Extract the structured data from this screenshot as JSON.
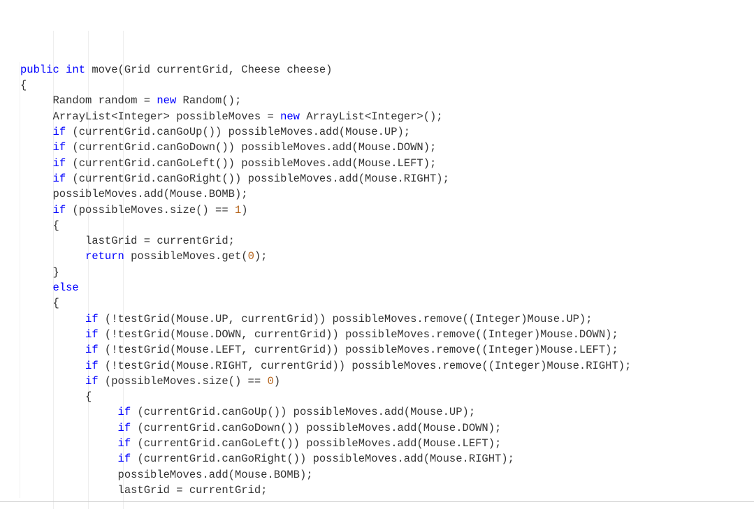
{
  "lines": [
    {
      "indent": 0,
      "tokens": [
        {
          "t": "public",
          "c": "keyword"
        },
        {
          "t": " "
        },
        {
          "t": "int",
          "c": "keyword"
        },
        {
          "t": " move(Grid currentGrid, Cheese cheese)"
        }
      ]
    },
    {
      "indent": 0,
      "tokens": [
        {
          "t": "{"
        }
      ]
    },
    {
      "indent": 5,
      "tokens": [
        {
          "t": "Random random = "
        },
        {
          "t": "new",
          "c": "keyword"
        },
        {
          "t": " Random();"
        }
      ]
    },
    {
      "indent": 5,
      "tokens": [
        {
          "t": "ArrayList<Integer> possibleMoves = "
        },
        {
          "t": "new",
          "c": "keyword"
        },
        {
          "t": " ArrayList<Integer>();"
        }
      ]
    },
    {
      "indent": 5,
      "tokens": [
        {
          "t": "if",
          "c": "keyword"
        },
        {
          "t": " (currentGrid.canGoUp()) possibleMoves.add(Mouse.UP);"
        }
      ]
    },
    {
      "indent": 5,
      "tokens": [
        {
          "t": "if",
          "c": "keyword"
        },
        {
          "t": " (currentGrid.canGoDown()) possibleMoves.add(Mouse.DOWN);"
        }
      ]
    },
    {
      "indent": 5,
      "tokens": [
        {
          "t": "if",
          "c": "keyword"
        },
        {
          "t": " (currentGrid.canGoLeft()) possibleMoves.add(Mouse.LEFT);"
        }
      ]
    },
    {
      "indent": 5,
      "tokens": [
        {
          "t": "if",
          "c": "keyword"
        },
        {
          "t": " (currentGrid.canGoRight()) possibleMoves.add(Mouse.RIGHT);"
        }
      ]
    },
    {
      "indent": 5,
      "tokens": [
        {
          "t": "possibleMoves.add(Mouse.BOMB);"
        }
      ]
    },
    {
      "indent": 0,
      "tokens": [
        {
          "t": ""
        }
      ]
    },
    {
      "indent": 5,
      "tokens": [
        {
          "t": "if",
          "c": "keyword"
        },
        {
          "t": " (possibleMoves.size() == "
        },
        {
          "t": "1",
          "c": "number"
        },
        {
          "t": ")"
        }
      ]
    },
    {
      "indent": 5,
      "tokens": [
        {
          "t": "{"
        }
      ]
    },
    {
      "indent": 10,
      "tokens": [
        {
          "t": "lastGrid = currentGrid;"
        }
      ]
    },
    {
      "indent": 10,
      "tokens": [
        {
          "t": "return",
          "c": "keyword"
        },
        {
          "t": " possibleMoves.get("
        },
        {
          "t": "0",
          "c": "number"
        },
        {
          "t": ");"
        }
      ]
    },
    {
      "indent": 5,
      "tokens": [
        {
          "t": "}"
        }
      ]
    },
    {
      "indent": 5,
      "tokens": [
        {
          "t": "else",
          "c": "keyword"
        }
      ]
    },
    {
      "indent": 5,
      "tokens": [
        {
          "t": "{"
        }
      ]
    },
    {
      "indent": 10,
      "tokens": [
        {
          "t": "if",
          "c": "keyword"
        },
        {
          "t": " (!testGrid(Mouse.UP, currentGrid)) possibleMoves.remove((Integer)Mouse.UP);"
        }
      ]
    },
    {
      "indent": 10,
      "tokens": [
        {
          "t": "if",
          "c": "keyword"
        },
        {
          "t": " (!testGrid(Mouse.DOWN, currentGrid)) possibleMoves.remove((Integer)Mouse.DOWN);"
        }
      ]
    },
    {
      "indent": 10,
      "tokens": [
        {
          "t": "if",
          "c": "keyword"
        },
        {
          "t": " (!testGrid(Mouse.LEFT, currentGrid)) possibleMoves.remove((Integer)Mouse.LEFT);"
        }
      ]
    },
    {
      "indent": 10,
      "tokens": [
        {
          "t": "if",
          "c": "keyword"
        },
        {
          "t": " (!testGrid(Mouse.RIGHT, currentGrid)) possibleMoves.remove((Integer)Mouse.RIGHT);"
        }
      ]
    },
    {
      "indent": 0,
      "tokens": [
        {
          "t": ""
        }
      ]
    },
    {
      "indent": 10,
      "tokens": [
        {
          "t": "if",
          "c": "keyword"
        },
        {
          "t": " (possibleMoves.size() == "
        },
        {
          "t": "0",
          "c": "number"
        },
        {
          "t": ")"
        }
      ]
    },
    {
      "indent": 10,
      "tokens": [
        {
          "t": "{"
        }
      ]
    },
    {
      "indent": 15,
      "tokens": [
        {
          "t": "if",
          "c": "keyword"
        },
        {
          "t": " (currentGrid.canGoUp()) possibleMoves.add(Mouse.UP);"
        }
      ]
    },
    {
      "indent": 15,
      "tokens": [
        {
          "t": "if",
          "c": "keyword"
        },
        {
          "t": " (currentGrid.canGoDown()) possibleMoves.add(Mouse.DOWN);"
        }
      ]
    },
    {
      "indent": 15,
      "tokens": [
        {
          "t": "if",
          "c": "keyword"
        },
        {
          "t": " (currentGrid.canGoLeft()) possibleMoves.add(Mouse.LEFT);"
        }
      ]
    },
    {
      "indent": 15,
      "tokens": [
        {
          "t": "if",
          "c": "keyword"
        },
        {
          "t": " (currentGrid.canGoRight()) possibleMoves.add(Mouse.RIGHT);"
        }
      ]
    },
    {
      "indent": 15,
      "tokens": [
        {
          "t": "possibleMoves.add(Mouse.BOMB);"
        }
      ]
    },
    {
      "indent": 0,
      "tokens": [
        {
          "t": ""
        }
      ]
    },
    {
      "indent": 15,
      "tokens": [
        {
          "t": "lastGrid = currentGrid;"
        }
      ]
    }
  ]
}
